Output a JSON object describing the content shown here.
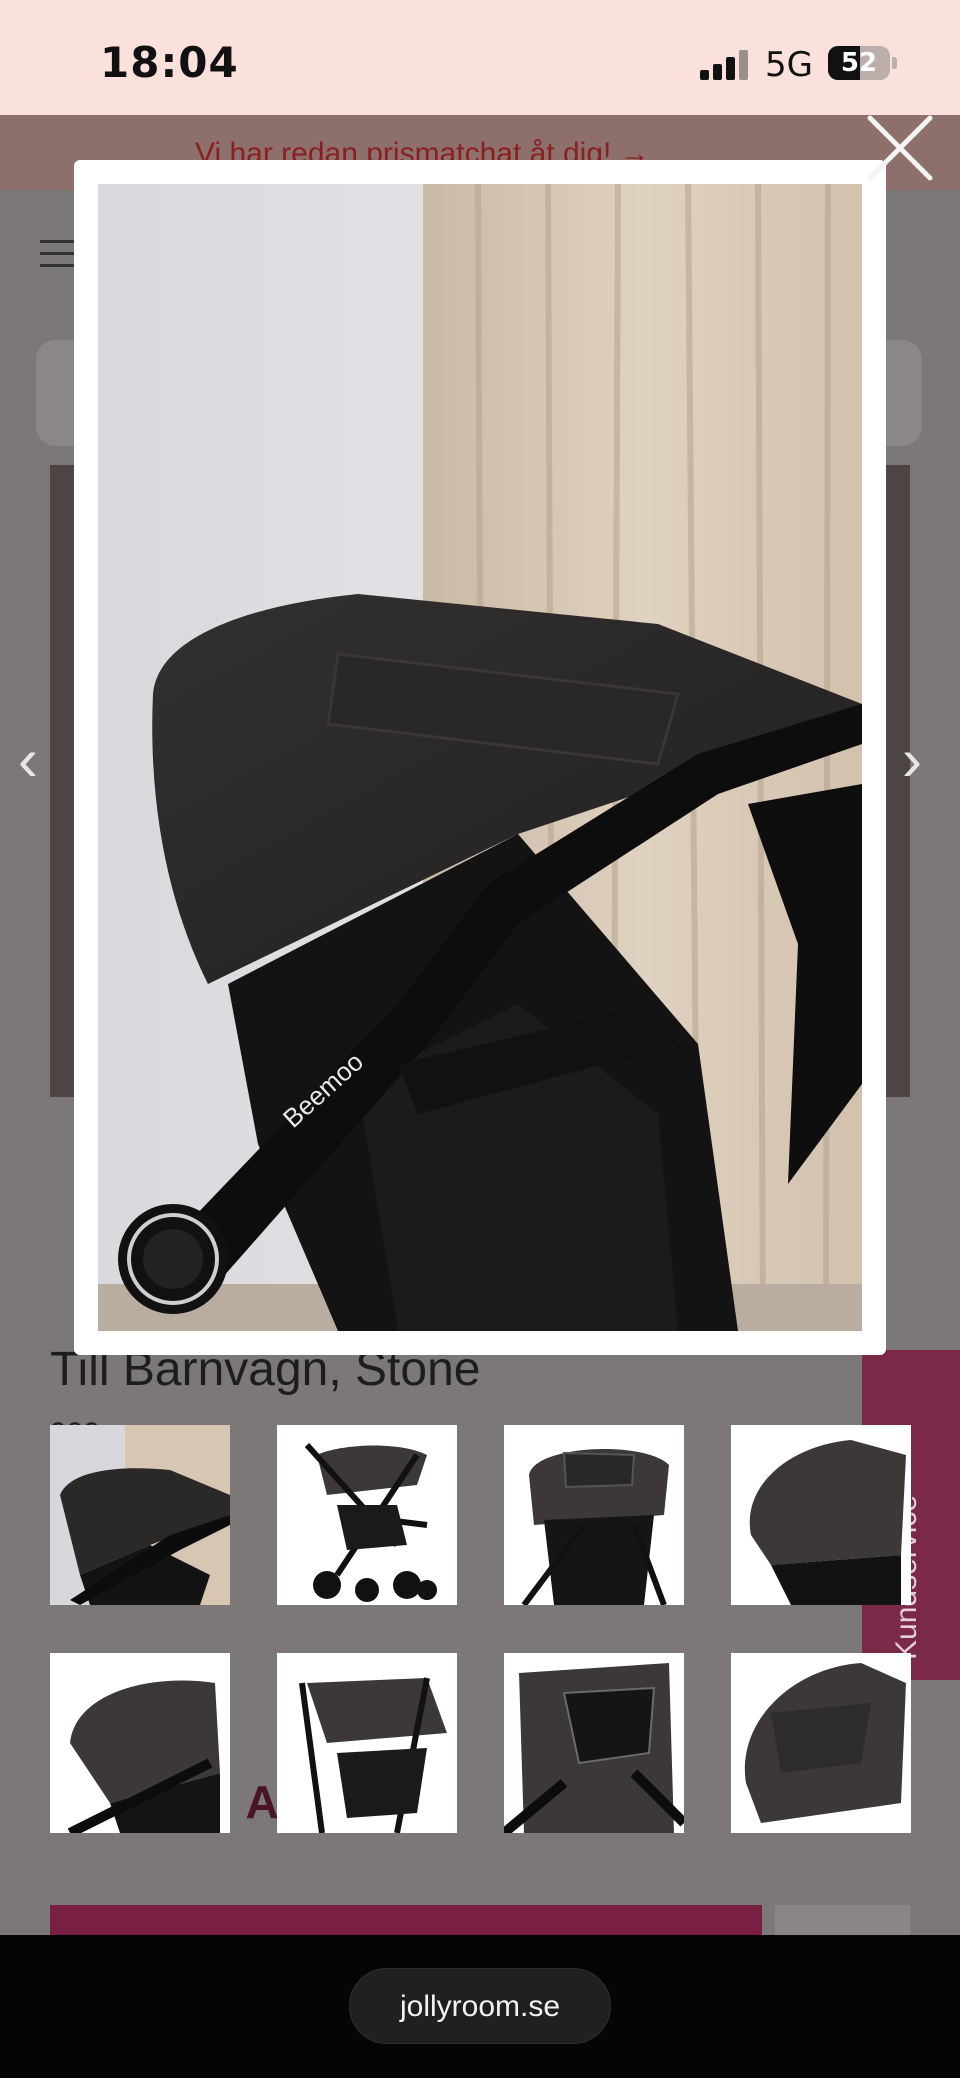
{
  "status_bar": {
    "time": "18:04",
    "network": "5G",
    "battery_level": "52",
    "battery_fraction": 0.52
  },
  "page": {
    "promo_banner": "Vi har redan prismatchat åt dig! →",
    "product_title": "Till Barnvagn, Stone",
    "sku_fragment": "909",
    "kundservice_label": "Kundservice",
    "partial_heading": "n e      AT      pa"
  },
  "modal": {
    "image_brand_label": "Beemoo",
    "close_icon": "close-icon",
    "thumbnails": [
      {
        "name": "thumb-1",
        "active": true
      },
      {
        "name": "thumb-2",
        "active": false
      },
      {
        "name": "thumb-3",
        "active": false
      },
      {
        "name": "thumb-4",
        "active": false
      },
      {
        "name": "thumb-5",
        "active": false
      },
      {
        "name": "thumb-6",
        "active": false
      },
      {
        "name": "thumb-7",
        "active": false
      },
      {
        "name": "thumb-8",
        "active": false
      }
    ]
  },
  "browser": {
    "url": "jollyroom.se"
  },
  "colors": {
    "status_bg": "#fbe1dc",
    "accent": "#7a1f44",
    "canopy": "#2b2828"
  }
}
